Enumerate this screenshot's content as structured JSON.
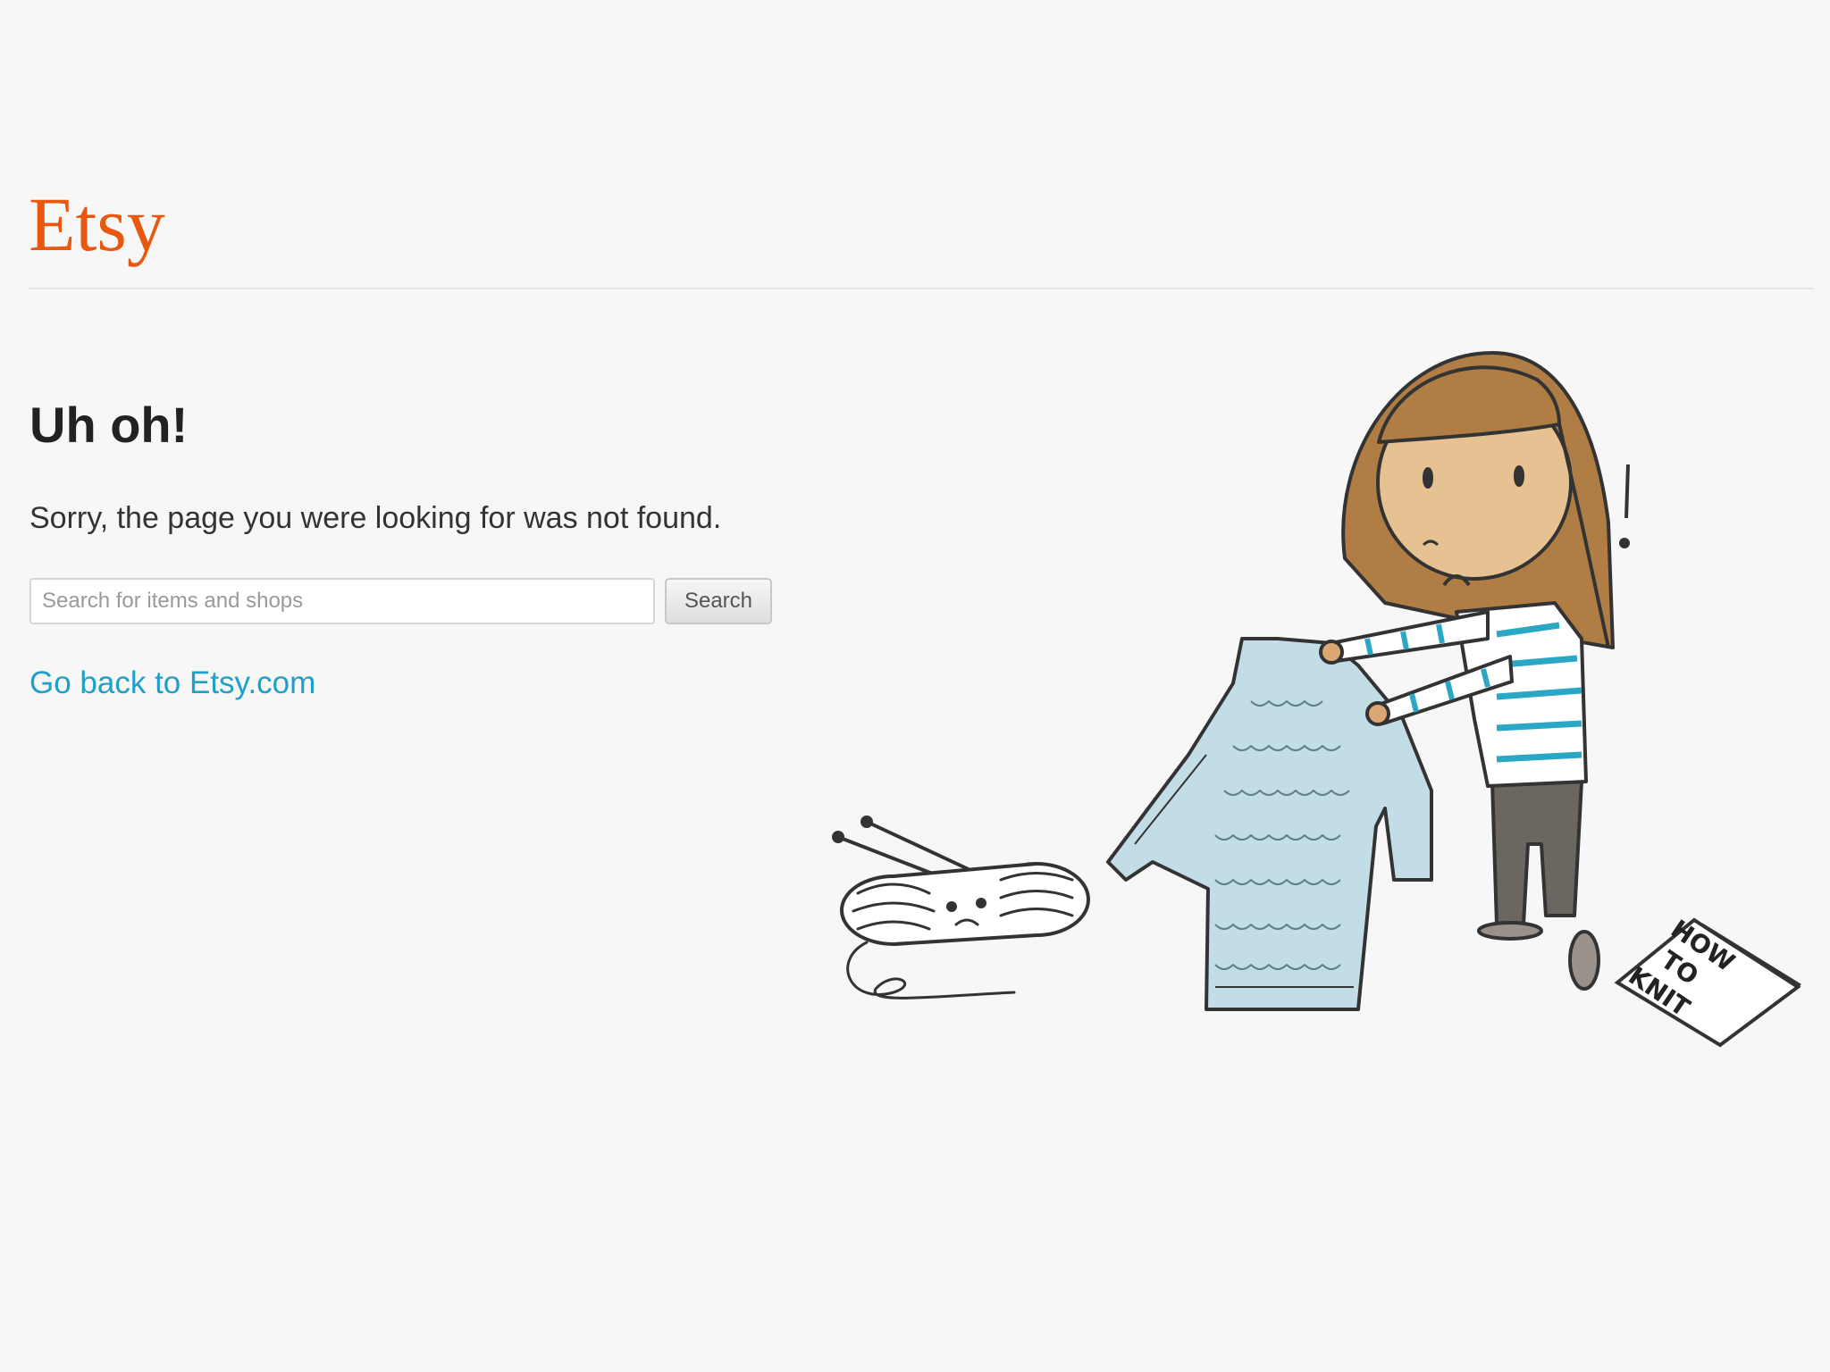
{
  "header": {
    "logo_text": "Etsy"
  },
  "main": {
    "heading": "Uh oh!",
    "message": "Sorry, the page you were looking for was not found.",
    "search": {
      "placeholder": "Search for items and shops",
      "value": "",
      "button_label": "Search"
    },
    "back_link": "Go back to Etsy.com"
  },
  "illustration": {
    "booklet_text": [
      "HOW",
      "TO",
      "KNIT"
    ],
    "exclamation": "!"
  },
  "colors": {
    "brand": "#e8590f",
    "link": "#1fa0c6",
    "heading": "#222222",
    "background": "#f7f7f7"
  }
}
